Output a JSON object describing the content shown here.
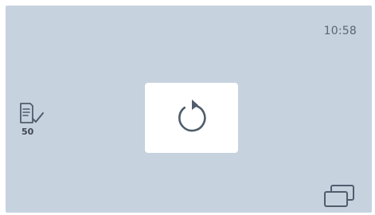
{
  "status_bar": {
    "time": "10:58"
  },
  "task_indicator": {
    "icon": "checklist-icon",
    "count": "50"
  },
  "main": {
    "refresh_icon": "refresh-icon"
  },
  "footer": {
    "window_icon": "windows-stack-icon"
  },
  "colors": {
    "background": "#c7d2df",
    "card": "#ffffff",
    "icon": "#4f5d6c",
    "text": "#5c6672"
  }
}
